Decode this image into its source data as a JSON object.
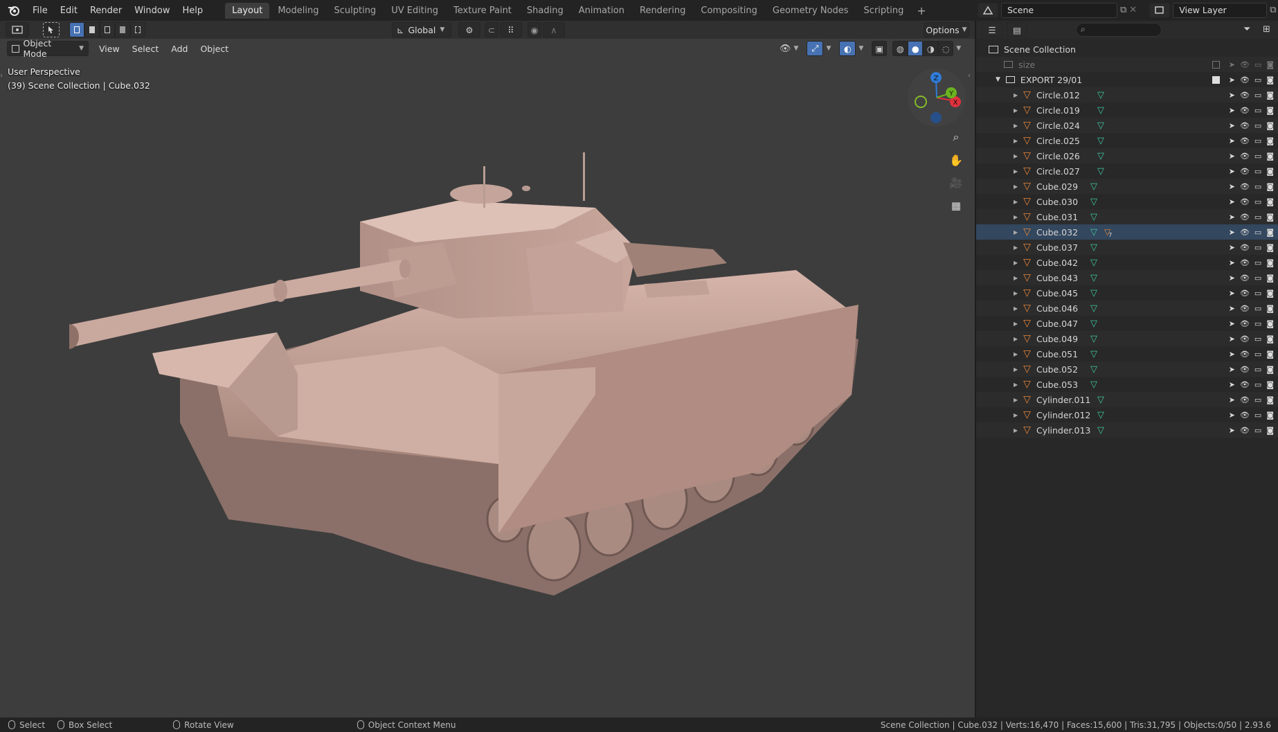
{
  "menu": {
    "file": "File",
    "edit": "Edit",
    "render": "Render",
    "window": "Window",
    "help": "Help"
  },
  "workspaces": [
    "Layout",
    "Modeling",
    "Sculpting",
    "UV Editing",
    "Texture Paint",
    "Shading",
    "Animation",
    "Rendering",
    "Compositing",
    "Geometry Nodes",
    "Scripting"
  ],
  "active_workspace": "Layout",
  "scene": {
    "name": "Scene",
    "view_layer": "View Layer"
  },
  "viewport": {
    "transform_orientation": "Global",
    "options_label": "Options",
    "mode": "Object Mode",
    "menus": [
      "View",
      "Select",
      "Add",
      "Object"
    ],
    "perspective": "User Perspective",
    "context": "(39) Scene Collection | Cube.032",
    "gizmo": {
      "x": "X",
      "y": "Y",
      "z": "Z"
    }
  },
  "outliner": {
    "search_placeholder": "",
    "scene_collection": "Scene Collection",
    "size_item": "size",
    "export_collection": "EXPORT 29/01",
    "objects": [
      "Circle.012",
      "Circle.019",
      "Circle.024",
      "Circle.025",
      "Circle.026",
      "Circle.027",
      "Cube.029",
      "Cube.030",
      "Cube.031",
      "Cube.032",
      "Cube.037",
      "Cube.042",
      "Cube.043",
      "Cube.045",
      "Cube.046",
      "Cube.047",
      "Cube.049",
      "Cube.051",
      "Cube.052",
      "Cube.053",
      "Cylinder.011",
      "Cylinder.012",
      "Cylinder.013"
    ],
    "selected": "Cube.032",
    "modifier_count": "7"
  },
  "status": {
    "select": "Select",
    "box_select": "Box Select",
    "rotate_view": "Rotate View",
    "context_menu": "Object Context Menu",
    "stats": "Scene Collection | Cube.032 | Verts:16,470 | Faces:15,600 | Tris:31,795 | Objects:0/50 | 2.93.6"
  },
  "colors": {
    "accent": "#4772b3",
    "mesh_icon": "#e8863a",
    "data_icon": "#3fc8a0",
    "model": "#c9a69b"
  }
}
